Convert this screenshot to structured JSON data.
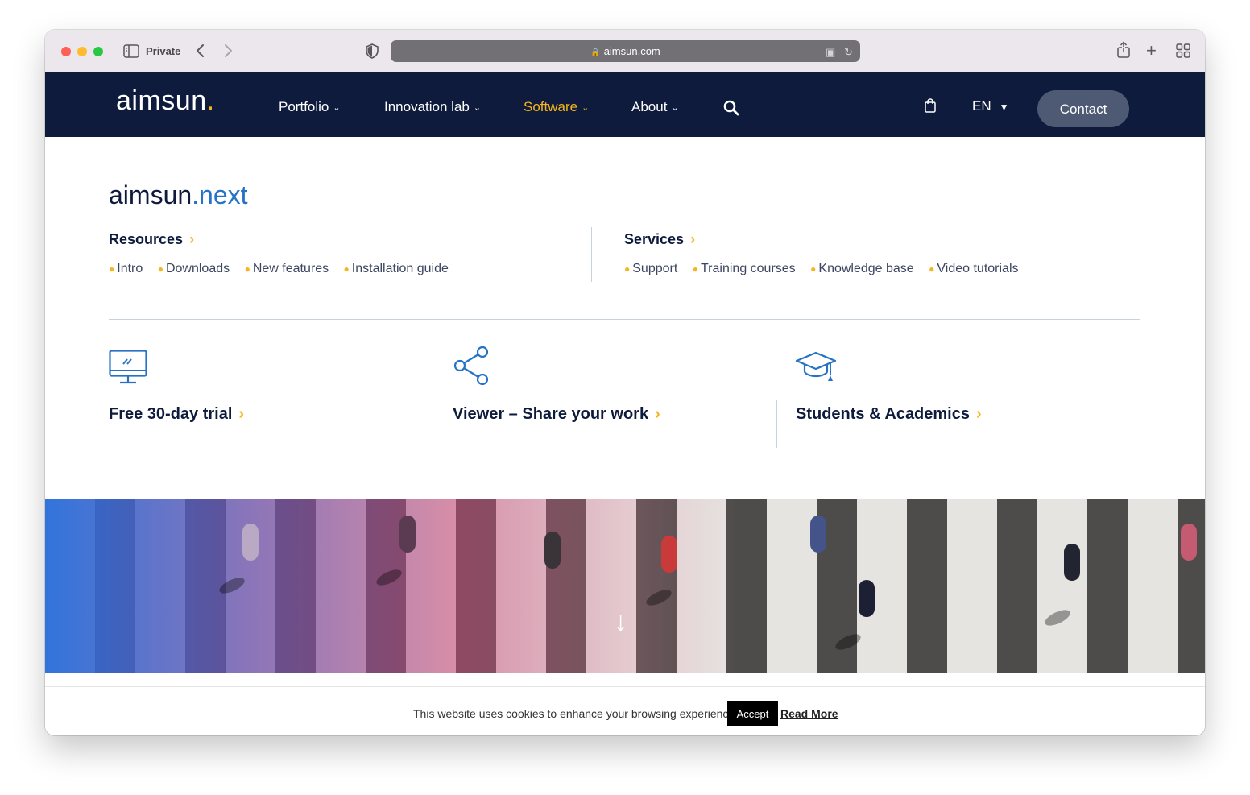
{
  "browser": {
    "private_label": "Private",
    "url": "aimsun.com"
  },
  "header": {
    "logo_text": "aimsun",
    "logo_dot": ".",
    "nav": [
      {
        "label": "Portfolio"
      },
      {
        "label": "Innovation lab"
      },
      {
        "label": "Software"
      },
      {
        "label": "About"
      }
    ],
    "language": "EN",
    "contact_label": "Contact"
  },
  "dropdown": {
    "product_main": "aimsun",
    "product_suffix": ".next",
    "resources": {
      "title": "Resources",
      "links": [
        "Intro",
        "Downloads",
        "New features",
        "Installation guide"
      ]
    },
    "services": {
      "title": "Services",
      "links": [
        "Support",
        "Training courses",
        "Knowledge base",
        "Video tutorials"
      ]
    },
    "features": [
      {
        "label": "Free 30-day trial"
      },
      {
        "label": "Viewer – Share your work"
      },
      {
        "label": "Students & Academics"
      }
    ]
  },
  "cookie": {
    "text": "This website uses cookies to enhance your browsing experience.",
    "accept": "Accept",
    "read_more": "Read More"
  },
  "colors": {
    "navy": "#0e1b3d",
    "accent_yellow": "#f5b51c",
    "accent_blue": "#2672c6"
  }
}
